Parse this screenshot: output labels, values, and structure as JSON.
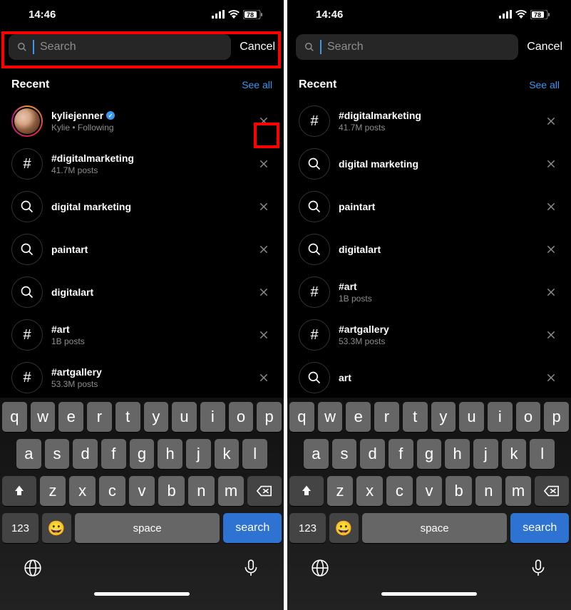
{
  "status": {
    "time": "14:46",
    "battery": "78"
  },
  "search": {
    "placeholder": "Search",
    "cancel": "Cancel"
  },
  "section": {
    "title": "Recent",
    "see_all": "See all"
  },
  "keyboard": {
    "row1": [
      "q",
      "w",
      "e",
      "r",
      "t",
      "y",
      "u",
      "i",
      "o",
      "p"
    ],
    "row2": [
      "a",
      "s",
      "d",
      "f",
      "g",
      "h",
      "j",
      "k",
      "l"
    ],
    "row3": [
      "z",
      "x",
      "c",
      "v",
      "b",
      "n",
      "m"
    ],
    "k123": "123",
    "space": "space",
    "search": "search"
  },
  "left_items": [
    {
      "type": "user",
      "title": "kyliejenner",
      "sub": "Kylie • Following",
      "verified": true,
      "highlight_close": true
    },
    {
      "type": "hash",
      "title": "#digitalmarketing",
      "sub": "41.7M posts"
    },
    {
      "type": "search",
      "title": "digital marketing",
      "sub": ""
    },
    {
      "type": "search",
      "title": "paintart",
      "sub": ""
    },
    {
      "type": "search",
      "title": "digitalart",
      "sub": ""
    },
    {
      "type": "hash",
      "title": "#art",
      "sub": "1B posts"
    },
    {
      "type": "hash",
      "title": "#artgallery",
      "sub": "53.3M posts"
    }
  ],
  "right_items": [
    {
      "type": "hash",
      "title": "#digitalmarketing",
      "sub": "41.7M posts"
    },
    {
      "type": "search",
      "title": "digital marketing",
      "sub": ""
    },
    {
      "type": "search",
      "title": "paintart",
      "sub": ""
    },
    {
      "type": "search",
      "title": "digitalart",
      "sub": ""
    },
    {
      "type": "hash",
      "title": "#art",
      "sub": "1B posts"
    },
    {
      "type": "hash",
      "title": "#artgallery",
      "sub": "53.3M posts"
    },
    {
      "type": "search",
      "title": "art",
      "sub": ""
    }
  ],
  "annotations": {
    "left_search_box": true,
    "left_close_box": true
  }
}
